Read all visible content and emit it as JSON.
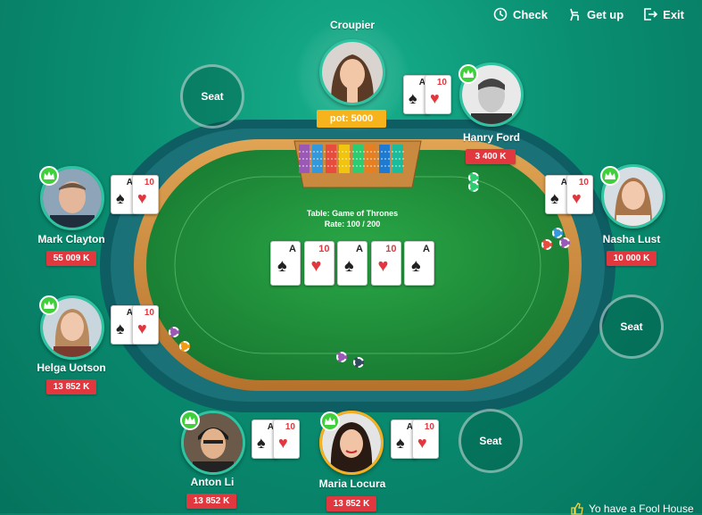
{
  "topbar": {
    "check": "Check",
    "get_up": "Get up",
    "exit": "Exit"
  },
  "croupier": {
    "label": "Croupier",
    "pot": "pot: 5000"
  },
  "table": {
    "name": "Table: Game of Thrones",
    "rate": "Rate: 100 / 200"
  },
  "players": {
    "hanry": {
      "name": "Hanry Ford",
      "chips": "3 400 K"
    },
    "mark": {
      "name": "Mark Clayton",
      "chips": "55 009 K"
    },
    "nasha": {
      "name": "Nasha Lust",
      "chips": "10 000 K"
    },
    "helga": {
      "name": "Helga Uotson",
      "chips": "13 852 K"
    },
    "anton": {
      "name": "Anton Li",
      "chips": "13 852 K"
    },
    "maria": {
      "name": "Maria Locura",
      "chips": "13 852 K"
    }
  },
  "seats": {
    "seat_top": "Seat",
    "seat_right": "Seat",
    "seat_bottom": "Seat"
  },
  "hole_cards": {
    "rank_a": "A",
    "rank_10": "10",
    "spade": "♠",
    "heart": "♥"
  },
  "community": [
    {
      "rank": "A",
      "suit": "♠",
      "color": "black"
    },
    {
      "rank": "10",
      "suit": "♥",
      "color": "red"
    },
    {
      "rank": "A",
      "suit": "♠",
      "color": "black"
    },
    {
      "rank": "10",
      "suit": "♥",
      "color": "red"
    },
    {
      "rank": "A",
      "suit": "♠",
      "color": "black"
    }
  ],
  "notice": "Yo have a Fool House",
  "colors": {
    "badge": "#e0383e",
    "pot": "#f7b31c",
    "crown": "#3fcf3b",
    "felt": "#1e8f3a"
  }
}
